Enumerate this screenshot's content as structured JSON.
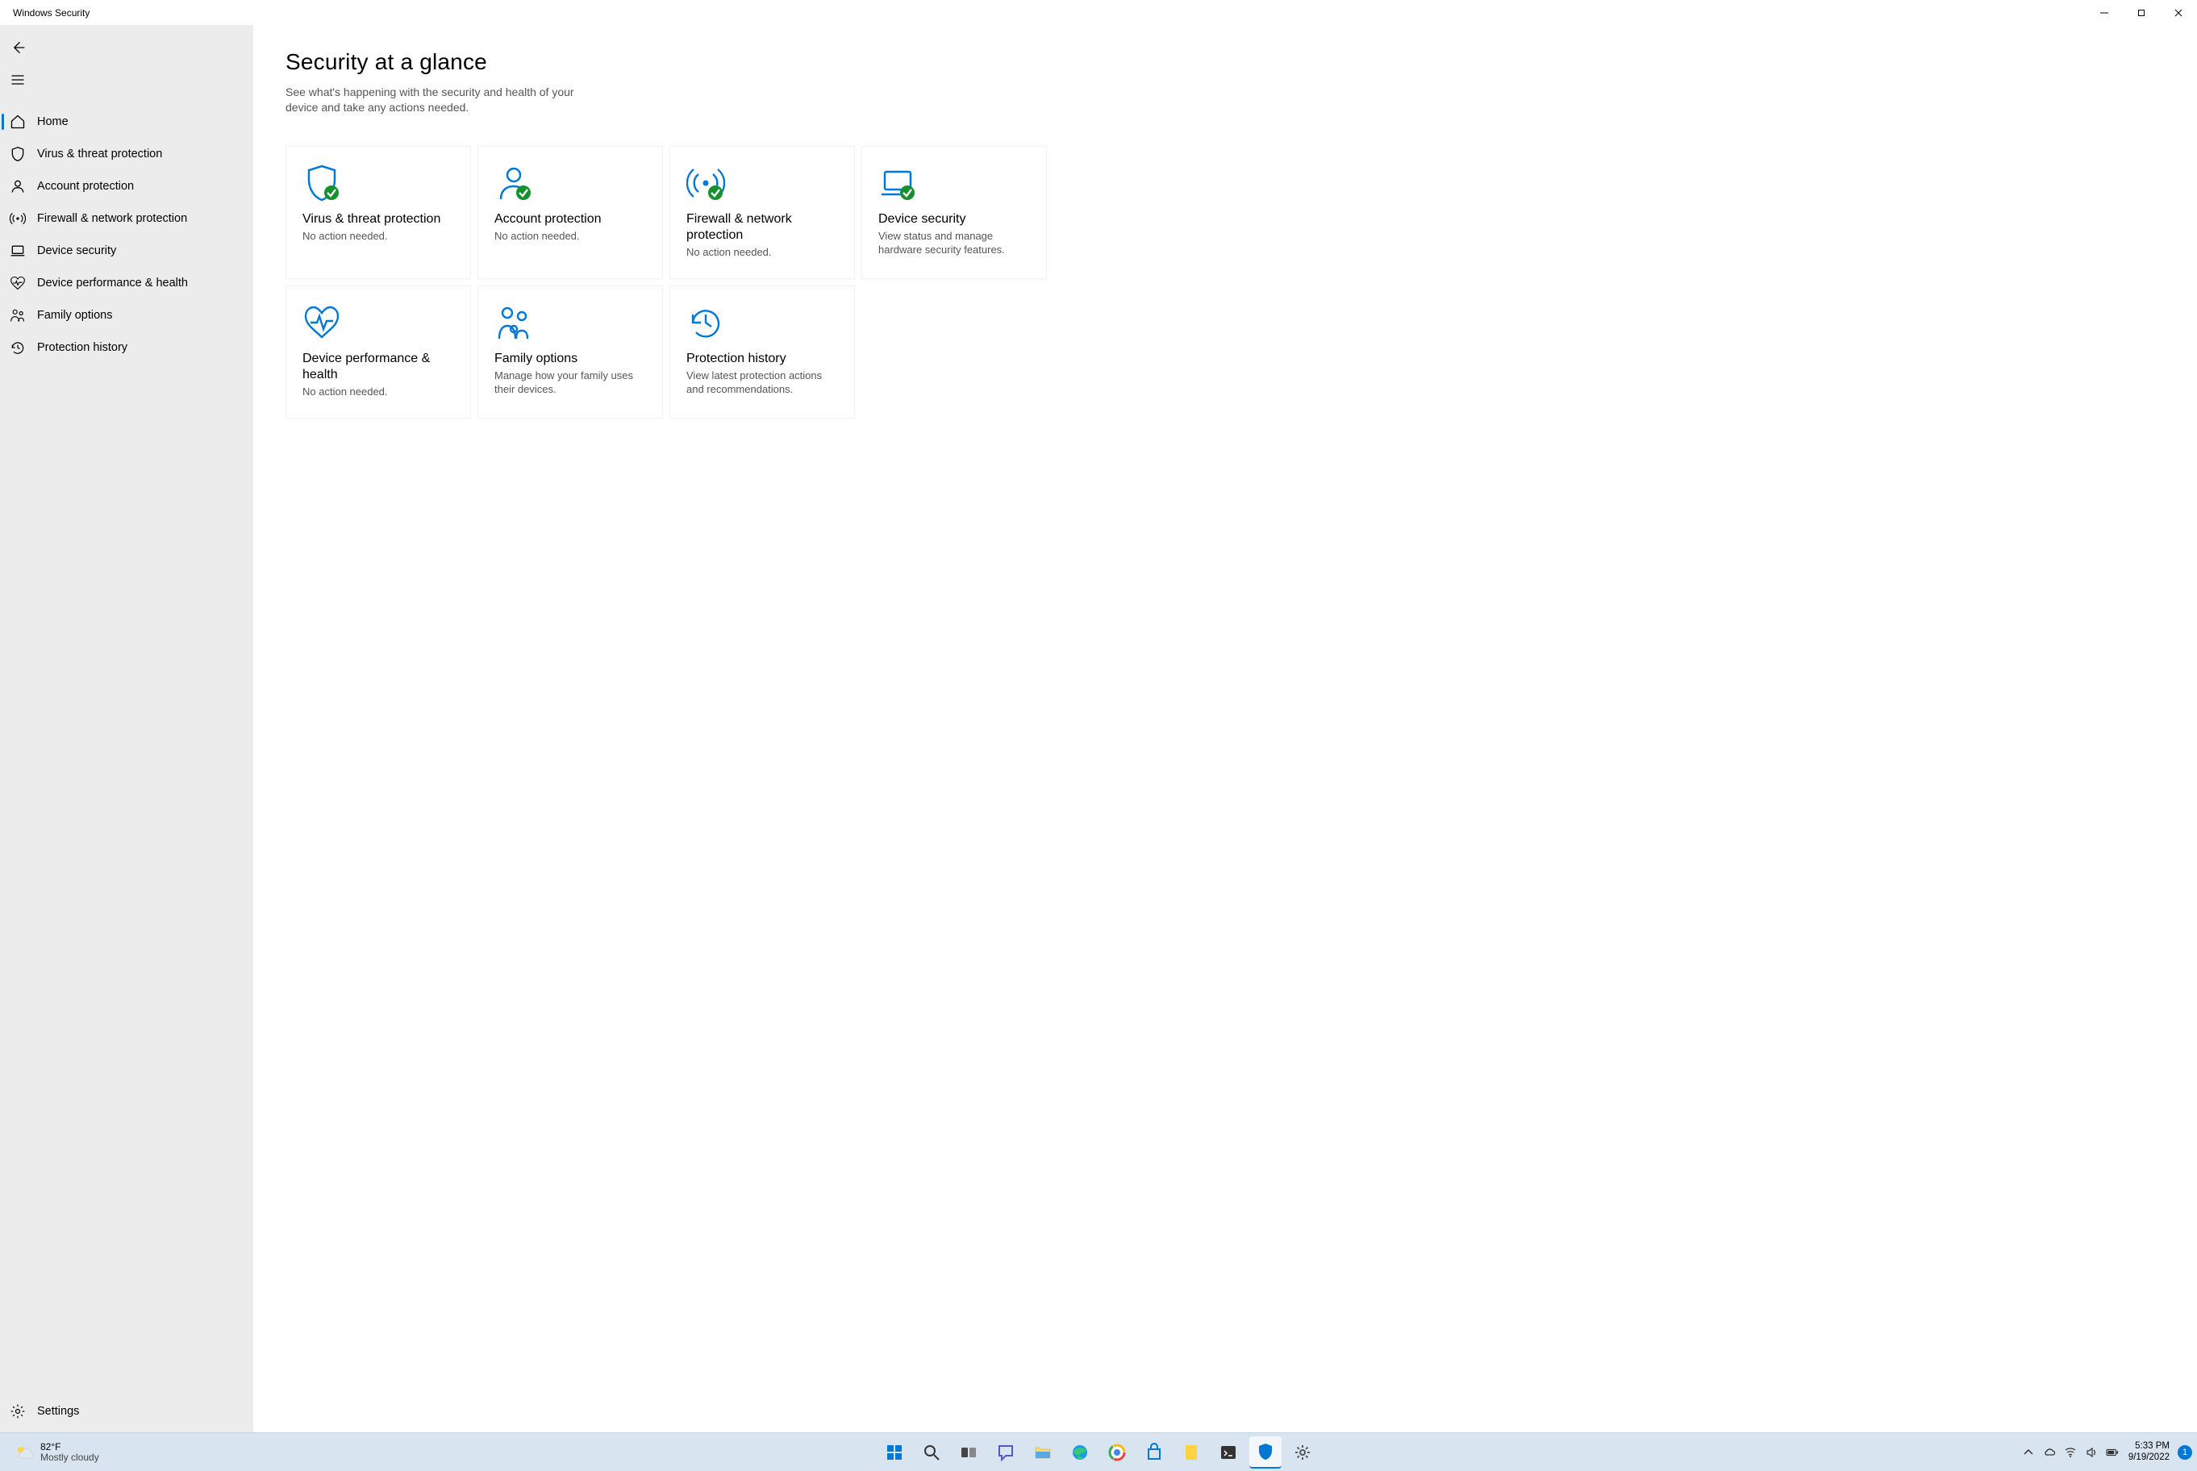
{
  "window": {
    "title": "Windows Security"
  },
  "sidebar": {
    "items": [
      {
        "label": "Home"
      },
      {
        "label": "Virus & threat protection"
      },
      {
        "label": "Account protection"
      },
      {
        "label": "Firewall & network protection"
      },
      {
        "label": "Device security"
      },
      {
        "label": "Device performance & health"
      },
      {
        "label": "Family options"
      },
      {
        "label": "Protection history"
      }
    ],
    "settings_label": "Settings"
  },
  "main": {
    "title": "Security at a glance",
    "subtitle": "See what's happening with the security and health of your device and take any actions needed.",
    "tiles": [
      {
        "title": "Virus & threat protection",
        "desc": "No action needed."
      },
      {
        "title": "Account protection",
        "desc": "No action needed."
      },
      {
        "title": "Firewall & network protection",
        "desc": "No action needed."
      },
      {
        "title": "Device security",
        "desc": "View status and manage hardware security features."
      },
      {
        "title": "Device performance & health",
        "desc": "No action needed."
      },
      {
        "title": "Family options",
        "desc": "Manage how your family uses their devices."
      },
      {
        "title": "Protection history",
        "desc": "View latest protection actions and recommendations."
      }
    ]
  },
  "taskbar": {
    "weather": {
      "temp": "82°F",
      "cond": "Mostly cloudy"
    },
    "time": "5:33 PM",
    "date": "9/19/2022",
    "notif_count": "1"
  },
  "colors": {
    "accent": "#0078d4",
    "ok_badge": "#17902e"
  }
}
